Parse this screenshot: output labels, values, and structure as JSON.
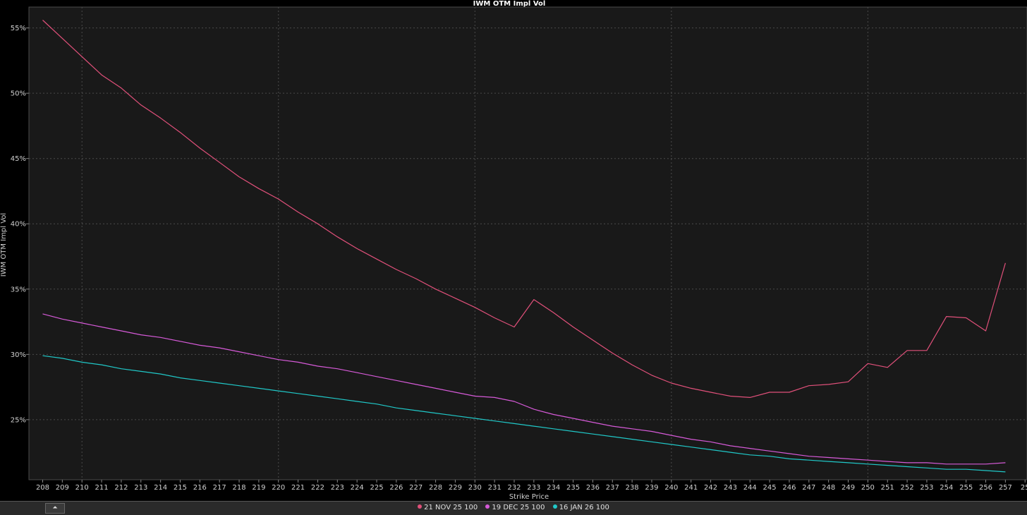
{
  "chart_data": {
    "type": "line",
    "title": "IWM OTM Impl Vol",
    "xlabel": "Strike Price",
    "ylabel": "IWM OTM Impl Vol",
    "x": [
      208,
      209,
      210,
      211,
      212,
      213,
      214,
      215,
      216,
      217,
      218,
      219,
      220,
      221,
      222,
      223,
      224,
      225,
      226,
      227,
      228,
      229,
      230,
      231,
      232,
      233,
      234,
      235,
      236,
      237,
      238,
      239,
      240,
      241,
      242,
      243,
      244,
      245,
      246,
      247,
      248,
      249,
      250,
      251,
      252,
      253,
      254,
      255,
      256,
      257
    ],
    "x_ticks": [
      "208",
      "209",
      "210",
      "211",
      "212",
      "213",
      "214",
      "215",
      "216",
      "217",
      "218",
      "219",
      "220",
      "221",
      "222",
      "223",
      "224",
      "225",
      "226",
      "227",
      "228",
      "229",
      "230",
      "231",
      "232",
      "233",
      "234",
      "235",
      "236",
      "237",
      "238",
      "239",
      "240",
      "241",
      "242",
      "243",
      "244",
      "245",
      "246",
      "247",
      "248",
      "249",
      "250",
      "251",
      "252",
      "253",
      "254",
      "255",
      "256",
      "257",
      "25"
    ],
    "y_ticks": [
      "55%",
      "50%",
      "45%",
      "40%",
      "35%",
      "30%",
      "25%"
    ],
    "y_tick_values": [
      55,
      50,
      45,
      40,
      35,
      30,
      25
    ],
    "ylim": [
      20.4,
      56.6
    ],
    "xlim": [
      207.3,
      258.1
    ],
    "grid": true,
    "legend_position": "bottom",
    "series": [
      {
        "name": "21 NOV 25 100",
        "color": "#e0507a",
        "values": [
          55.6,
          54.2,
          52.8,
          51.4,
          50.4,
          49.1,
          48.1,
          47.0,
          45.8,
          44.7,
          43.6,
          42.7,
          41.9,
          40.9,
          40.0,
          39.0,
          38.1,
          37.3,
          36.5,
          35.8,
          35.0,
          34.3,
          33.6,
          32.8,
          32.1,
          34.2,
          33.2,
          32.1,
          31.1,
          30.1,
          29.2,
          28.4,
          27.8,
          27.4,
          27.1,
          26.8,
          26.7,
          27.1,
          27.1,
          27.6,
          27.7,
          27.9,
          29.3,
          29.0,
          30.3,
          30.3,
          32.9,
          32.8,
          31.8,
          37.0
        ]
      },
      {
        "name": "19 DEC 25 100",
        "color": "#d65ad8",
        "values": [
          33.1,
          32.7,
          32.4,
          32.1,
          31.8,
          31.5,
          31.3,
          31.0,
          30.7,
          30.5,
          30.2,
          29.9,
          29.6,
          29.4,
          29.1,
          28.9,
          28.6,
          28.3,
          28.0,
          27.7,
          27.4,
          27.1,
          26.8,
          26.7,
          26.4,
          25.8,
          25.4,
          25.1,
          24.8,
          24.5,
          24.3,
          24.1,
          23.8,
          23.5,
          23.3,
          23.0,
          22.8,
          22.6,
          22.4,
          22.2,
          22.1,
          22.0,
          21.9,
          21.8,
          21.7,
          21.7,
          21.6,
          21.6,
          21.6,
          21.7
        ]
      },
      {
        "name": "16 JAN 26 100",
        "color": "#20c8c8",
        "values": [
          29.9,
          29.7,
          29.4,
          29.2,
          28.9,
          28.7,
          28.5,
          28.2,
          28.0,
          27.8,
          27.6,
          27.4,
          27.2,
          27.0,
          26.8,
          26.6,
          26.4,
          26.2,
          25.9,
          25.7,
          25.5,
          25.3,
          25.1,
          24.9,
          24.7,
          24.5,
          24.3,
          24.1,
          23.9,
          23.7,
          23.5,
          23.3,
          23.1,
          22.9,
          22.7,
          22.5,
          22.3,
          22.2,
          22.0,
          21.9,
          21.8,
          21.7,
          21.6,
          21.5,
          21.4,
          21.3,
          21.2,
          21.2,
          21.1,
          21.0
        ]
      }
    ]
  },
  "legend": {
    "items": [
      {
        "label": "21 NOV 25 100",
        "color": "#e0507a"
      },
      {
        "label": "19 DEC 25 100",
        "color": "#d65ad8"
      },
      {
        "label": "16 JAN 26 100",
        "color": "#20c8c8"
      }
    ]
  },
  "toolbar": {
    "collapse_icon": "collapse-up-icon",
    "collapse_glyph": "⏶"
  }
}
